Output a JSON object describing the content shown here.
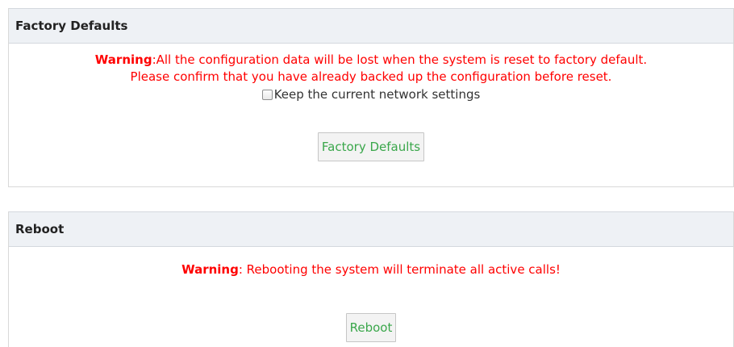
{
  "factory_defaults": {
    "title": "Factory Defaults",
    "warning_label": "Warning",
    "warning_text": ":All the configuration data will be lost when the system is reset to factory default.",
    "confirm_text": "Please confirm that you have already backed up the configuration before reset.",
    "keep_network_label": "Keep the current network settings",
    "keep_network_checked": false,
    "button_label": "Factory Defaults"
  },
  "reboot": {
    "title": "Reboot",
    "warning_label": "Warning",
    "warning_text": ": Rebooting the system will terminate all active calls!",
    "button_label": "Reboot"
  },
  "colors": {
    "warning_red": "#ff0000",
    "button_text_green": "#3aa74b",
    "header_bg": "#eef1f5"
  }
}
